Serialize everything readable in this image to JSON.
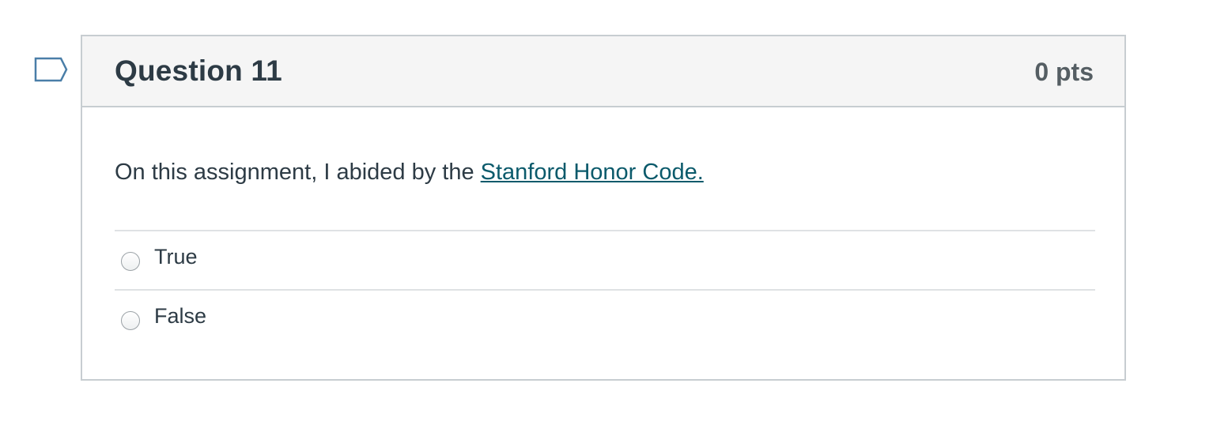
{
  "question": {
    "title": "Question 11",
    "points": "0 pts",
    "text_prefix": "On this assignment, I abided by the ",
    "link_text": "Stanford Honor Code.",
    "answers": [
      {
        "label": "True",
        "selected": false
      },
      {
        "label": "False",
        "selected": false
      }
    ]
  },
  "icons": {
    "flag": "flag-outline-icon"
  },
  "colors": {
    "header_bg": "#f5f5f5",
    "border": "#c7cdd1",
    "text": "#2d3b45",
    "link": "#0b5a6b",
    "flag_stroke": "#4a7ea8"
  }
}
